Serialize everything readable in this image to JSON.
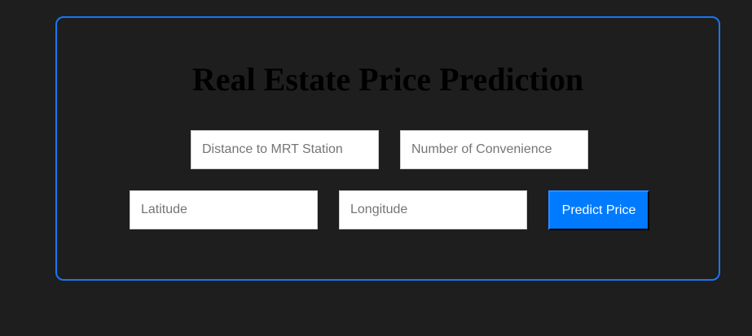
{
  "form": {
    "title": "Real Estate Price Prediction",
    "fields": [
      {
        "placeholder": "Distance to MRT Station",
        "value": ""
      },
      {
        "placeholder": "Number of Convenience",
        "value": ""
      },
      {
        "placeholder": "Latitude",
        "value": ""
      },
      {
        "placeholder": "Longitude",
        "value": ""
      }
    ],
    "submit_label": "Predict Price"
  },
  "colors": {
    "background": "#1e1e1e",
    "card_border": "#1877f2",
    "button": "#007bff",
    "button_text": "#ffffff",
    "title_text": "#000000"
  }
}
